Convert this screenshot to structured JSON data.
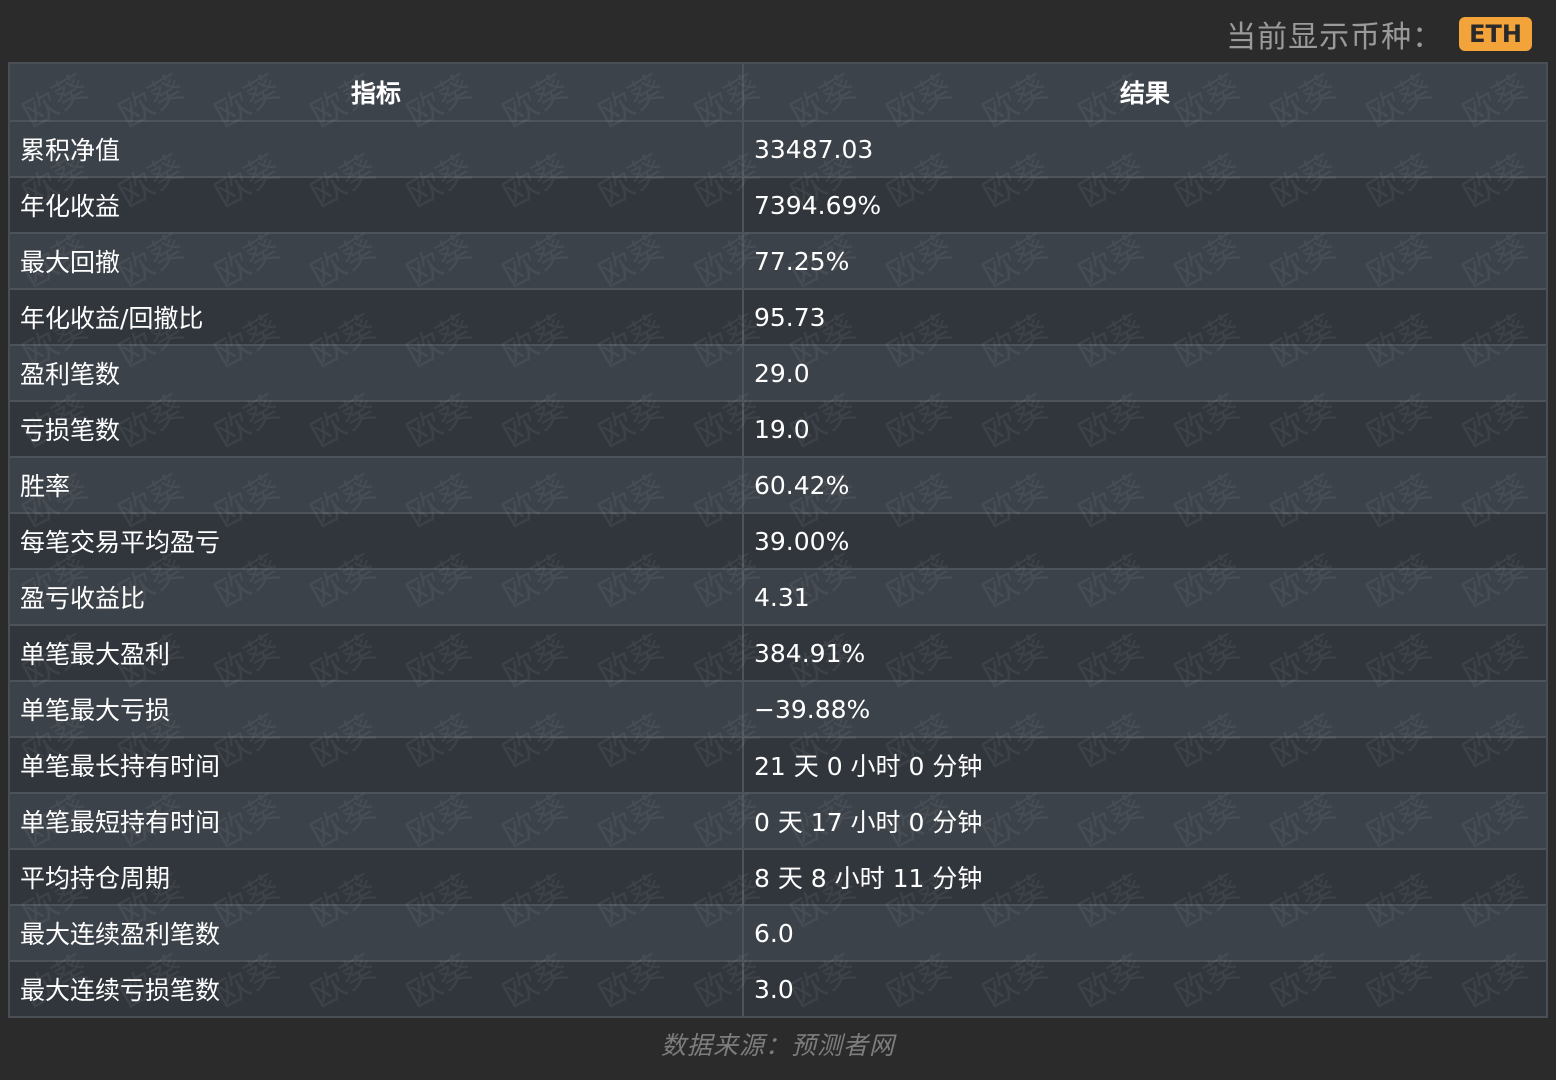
{
  "header": {
    "label": "当前显示币种：",
    "currency": "ETH",
    "badge_color": "#f2a33a"
  },
  "table": {
    "columns": [
      "指标",
      "结果"
    ],
    "rows": [
      [
        "累积净值",
        "33487.03"
      ],
      [
        "年化收益",
        "7394.69%"
      ],
      [
        "最大回撤",
        "77.25%"
      ],
      [
        "年化收益/回撤比",
        "95.73"
      ],
      [
        "盈利笔数",
        "29.0"
      ],
      [
        "亏损笔数",
        "19.0"
      ],
      [
        "胜率",
        "60.42%"
      ],
      [
        "每笔交易平均盈亏",
        "39.00%"
      ],
      [
        "盈亏收益比",
        "4.31"
      ],
      [
        "单笔最大盈利",
        "384.91%"
      ],
      [
        "单笔最大亏损",
        "−39.88%"
      ],
      [
        "单笔最长持有时间",
        "21 天 0 小时 0 分钟"
      ],
      [
        "单笔最短持有时间",
        "0 天 17 小时 0 分钟"
      ],
      [
        "平均持仓周期",
        "8 天 8 小时 11 分钟"
      ],
      [
        "最大连续盈利笔数",
        "6.0"
      ],
      [
        "最大连续亏损笔数",
        "3.0"
      ]
    ]
  },
  "watermark": "欧葵",
  "footer": "数据来源：预测者网"
}
